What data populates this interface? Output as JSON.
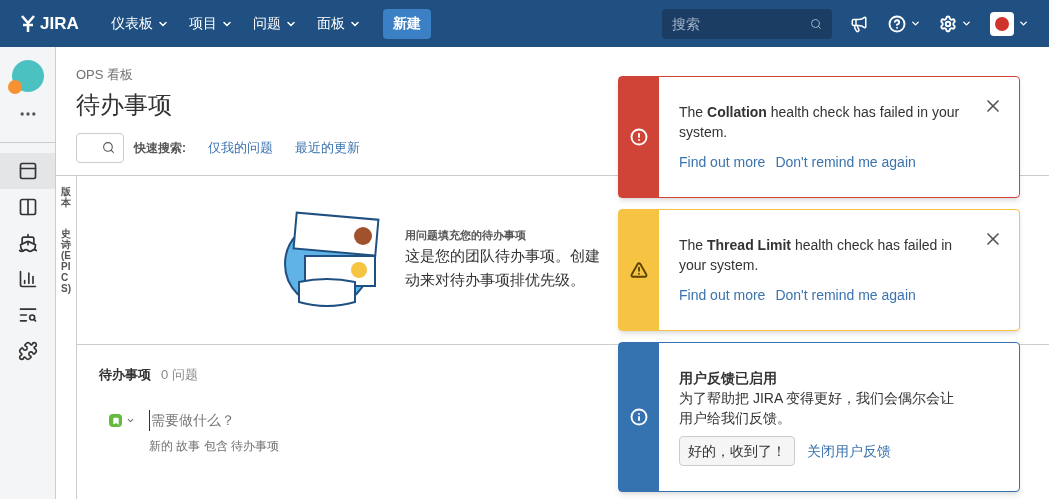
{
  "nav": {
    "logo": "JIRA",
    "menus": [
      {
        "label": "仪表板"
      },
      {
        "label": "项目"
      },
      {
        "label": "问题"
      },
      {
        "label": "面板"
      }
    ],
    "create": "新建",
    "search": {
      "placeholder": "搜索"
    }
  },
  "sidebar": {
    "items": [
      {
        "kind": "backlog",
        "selected": true
      },
      {
        "kind": "board",
        "selected": false
      },
      {
        "kind": "releases",
        "selected": false
      },
      {
        "kind": "reports",
        "selected": false
      },
      {
        "kind": "search",
        "selected": false
      },
      {
        "kind": "addons",
        "selected": false
      }
    ]
  },
  "header": {
    "breadcrumb": "OPS 看板",
    "title": "待办事项",
    "quick_search_label": "快速搜索:",
    "quick_filters": [
      "仅我的问题",
      "最近的更新"
    ]
  },
  "side_tabs": [
    "版本",
    "史诗(EPICS)"
  ],
  "empty_state": {
    "heading": "用问题填充您的待办事项",
    "lines": [
      "这是您的团队待办事项。创建",
      "动来对待办事项排优先级。"
    ]
  },
  "backlog": {
    "title": "待办事项",
    "count": "0 问题",
    "input": {
      "placeholder": "需要做什么？"
    },
    "hint": "新的 故事 包含 待办事项"
  },
  "flags": [
    {
      "kind": "error",
      "message": "The **Collation** health check has failed in your system.",
      "actions": [
        "Find out more",
        "Don't remind me again"
      ]
    },
    {
      "kind": "warning",
      "message": "The **Thread Limit** health check has failed in your system.",
      "actions": [
        "Find out more",
        "Don't remind me again"
      ]
    },
    {
      "kind": "info",
      "title": "用户反馈已启用",
      "message": "为了帮助把 JIRA 变得更好，我们会偶尔会让用户给我们反馈。",
      "button": "好的，收到了！",
      "link": "关闭用户反馈"
    }
  ]
}
